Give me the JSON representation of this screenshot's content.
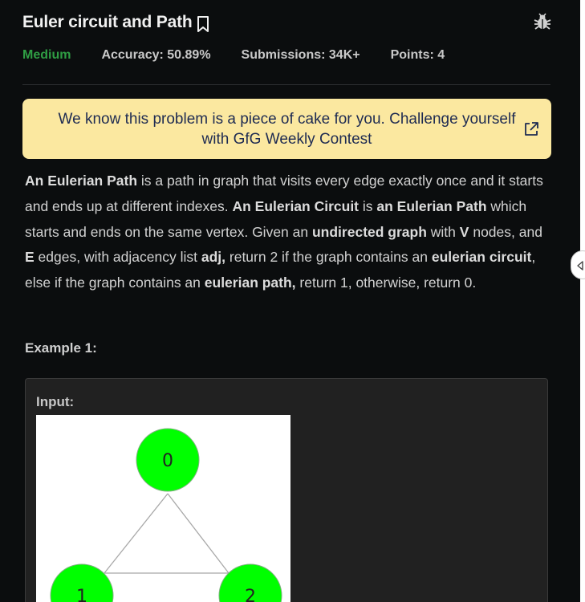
{
  "problem": {
    "title": "Euler circuit and Path",
    "difficulty": "Medium",
    "accuracy": "Accuracy: 50.89%",
    "submissions": "Submissions: 34K+",
    "points": "Points: 4"
  },
  "banner": {
    "text": "We know this problem is a piece of cake for you. Challenge yourself with GfG Weekly Contest"
  },
  "description": {
    "s1": "An Eulerian Path",
    "s2": " is a path in graph that visits every edge exactly once and it starts and ends up at different indexes. ",
    "s3": "An Eulerian Circuit",
    "s4": " is ",
    "s5": "an Eulerian Path",
    "s6": " which starts and ends on the same vertex. Given an ",
    "s7": "undirected graph",
    "s8": " with ",
    "s9": "V",
    "s10": " nodes, and ",
    "s11": "E",
    "s12": " edges, with adjacency list ",
    "s13": "adj,",
    "s14": " return 2 if the graph contains an ",
    "s15": "eulerian circuit",
    "s16": ", else if the graph contains an ",
    "s17": "eulerian path,",
    "s18": " return 1, otherwise, return 0."
  },
  "example": {
    "heading": "Example 1:",
    "input_label": "Input:",
    "graph_nodes": [
      "0",
      "1",
      "2"
    ],
    "node_color": "#00ff00"
  },
  "icons": {
    "bookmark": "bookmark-icon",
    "bug": "bug-icon",
    "external": "external-link-icon",
    "collapse": "caret-left-icon"
  }
}
